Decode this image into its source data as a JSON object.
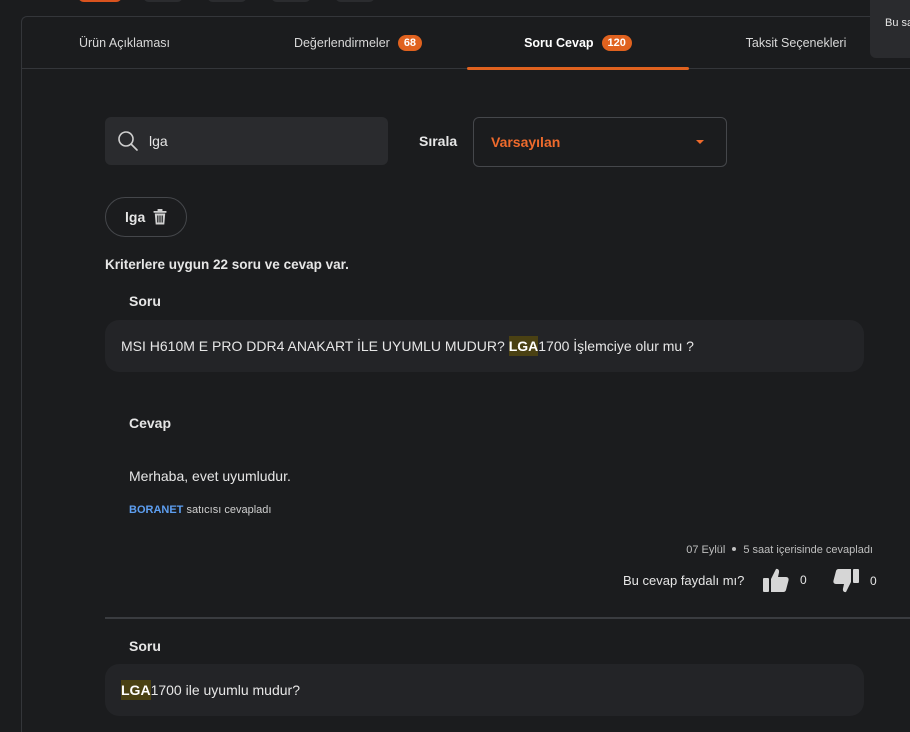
{
  "tabs": [
    {
      "label": "Ürün Açıklaması",
      "badge": ""
    },
    {
      "label": "Değerlendirmeler",
      "badge": "68"
    },
    {
      "label": "Soru Cevap",
      "badge": "120"
    },
    {
      "label": "Taksit Seçenekleri",
      "badge": ""
    }
  ],
  "tooltip": {
    "text": "Bu sa"
  },
  "search": {
    "value": "lga"
  },
  "sort": {
    "label": "Sırala",
    "selected": "Varsayılan"
  },
  "filter_chip": {
    "label": "lga"
  },
  "result_count": "Kriterlere uygun 22 soru ve cevap var.",
  "qa": [
    {
      "question_label": "Soru",
      "question_pre": "MSI H610M E PRO DDR4 ANAKART İLE UYUMLU MUDUR? ",
      "question_hl": "LGA",
      "question_post": "1700 İşlemciye olur mu ?",
      "answer_label": "Cevap",
      "answer": "Merhaba, evet uyumludur.",
      "seller_name": "BORANET",
      "seller_suffix": " satıcısı cevapladı",
      "date": "07 Eylül",
      "answered_in": "5 saat içerisinde cevapladı",
      "helpful_label": "Bu cevap faydalı mı?",
      "likes": "0",
      "dislikes": "0"
    },
    {
      "question_label": "Soru",
      "question_hl": "LGA",
      "question_post": "1700 ile uyumlu mudur?"
    }
  ],
  "colors": {
    "accent": "#e0621f",
    "highlight": "#4a4113",
    "seller": "#5d9ef0"
  }
}
